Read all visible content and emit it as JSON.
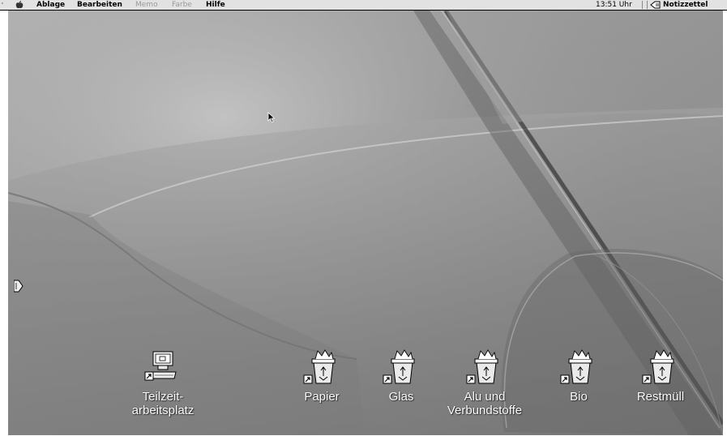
{
  "menubar": {
    "items": [
      {
        "label": "Ablage",
        "enabled": true
      },
      {
        "label": "Bearbeiten",
        "enabled": true
      },
      {
        "label": "Memo",
        "enabled": false
      },
      {
        "label": "Farbe",
        "enabled": false
      },
      {
        "label": "Hilfe",
        "enabled": true
      }
    ],
    "clock": "13:51 Uhr",
    "app_name": "Notizzettel"
  },
  "desktop_icons": [
    {
      "label": "Teilzeit-\narbeitsplatz",
      "icon": "workstation-alias-icon"
    },
    {
      "label": "Papier",
      "icon": "recycle-bin-icon"
    },
    {
      "label": "Glas",
      "icon": "recycle-bin-icon"
    },
    {
      "label": "Alu und\nVerbundstoffe",
      "icon": "recycle-bin-icon"
    },
    {
      "label": "Bio",
      "icon": "recycle-bin-icon"
    },
    {
      "label": "Restmüll",
      "icon": "recycle-bin-icon"
    }
  ]
}
